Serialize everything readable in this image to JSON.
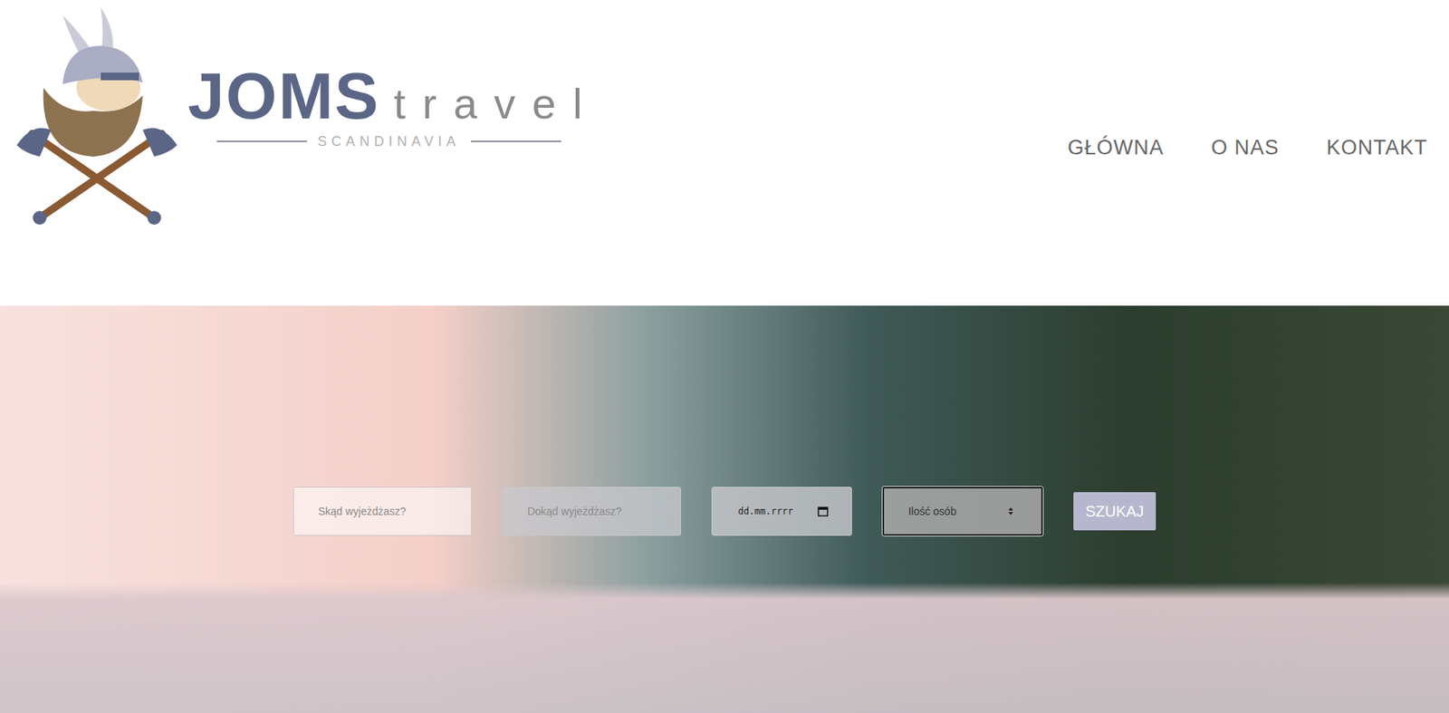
{
  "logo": {
    "brand": "JOMS",
    "suffix": "travel",
    "tagline": "SCANDINAVIA"
  },
  "nav": [
    {
      "label": "GŁÓWNA"
    },
    {
      "label": "O NAS"
    },
    {
      "label": "KONTAKT"
    }
  ],
  "search": {
    "fields": [
      {
        "kind": "text",
        "text": "Skąd wyjeżdżasz?",
        "focused": false
      },
      {
        "kind": "text",
        "text": "Dokąd wyjeżdżasz?",
        "focused": false
      },
      {
        "kind": "date",
        "text": "dd.mm.rrrr",
        "focused": false
      },
      {
        "kind": "select",
        "text": "Ilość osób",
        "focused": true
      }
    ],
    "button": "SZUKAJ"
  }
}
